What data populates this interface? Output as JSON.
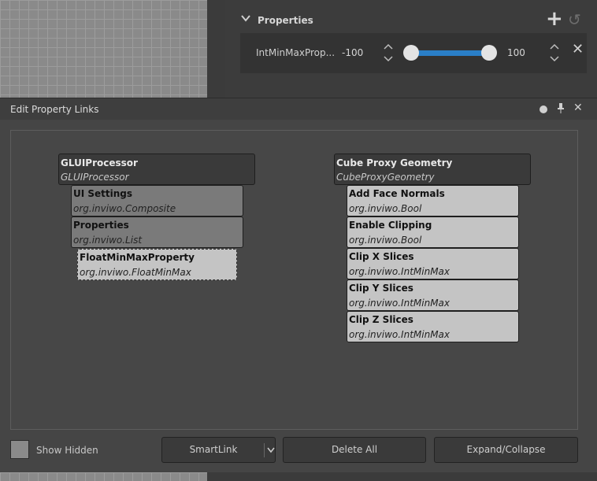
{
  "property_panel": {
    "section_title": "Properties",
    "row": {
      "label": "IntMinMaxProp...",
      "min_value": "-100",
      "max_value": "100"
    }
  },
  "dialog": {
    "title": "Edit Property Links",
    "source_processor": {
      "name": "GLUIProcessor",
      "class": "GLUIProcessor",
      "properties": [
        {
          "name": "UI Settings",
          "class": "org.inviwo.Composite"
        },
        {
          "name": "Properties",
          "class": "org.inviwo.List"
        }
      ],
      "sub_property": {
        "name": "FloatMinMaxProperty",
        "class": "org.inviwo.FloatMinMax"
      }
    },
    "target_processor": {
      "name": "Cube Proxy Geometry",
      "class": "CubeProxyGeometry",
      "properties": [
        {
          "name": "Add Face Normals",
          "class": "org.inviwo.Bool"
        },
        {
          "name": "Enable Clipping",
          "class": "org.inviwo.Bool"
        },
        {
          "name": "Clip X Slices",
          "class": "org.inviwo.IntMinMax"
        },
        {
          "name": "Clip Y Slices",
          "class": "org.inviwo.IntMinMax"
        },
        {
          "name": "Clip Z Slices",
          "class": "org.inviwo.IntMinMax"
        }
      ]
    },
    "footer": {
      "show_hidden_label": "Show Hidden",
      "smartlink_label": "SmartLink",
      "delete_all_label": "Delete All",
      "expand_collapse_label": "Expand/Collapse"
    }
  },
  "icons": {
    "collapse": "chevron-down-icon",
    "add": "plus-icon",
    "reset": "undo-icon",
    "remove": "close-icon",
    "float": "dot-icon",
    "pin": "pin-icon",
    "close": "close-icon"
  },
  "colors": {
    "slider_accent": "#2a7fc8"
  }
}
